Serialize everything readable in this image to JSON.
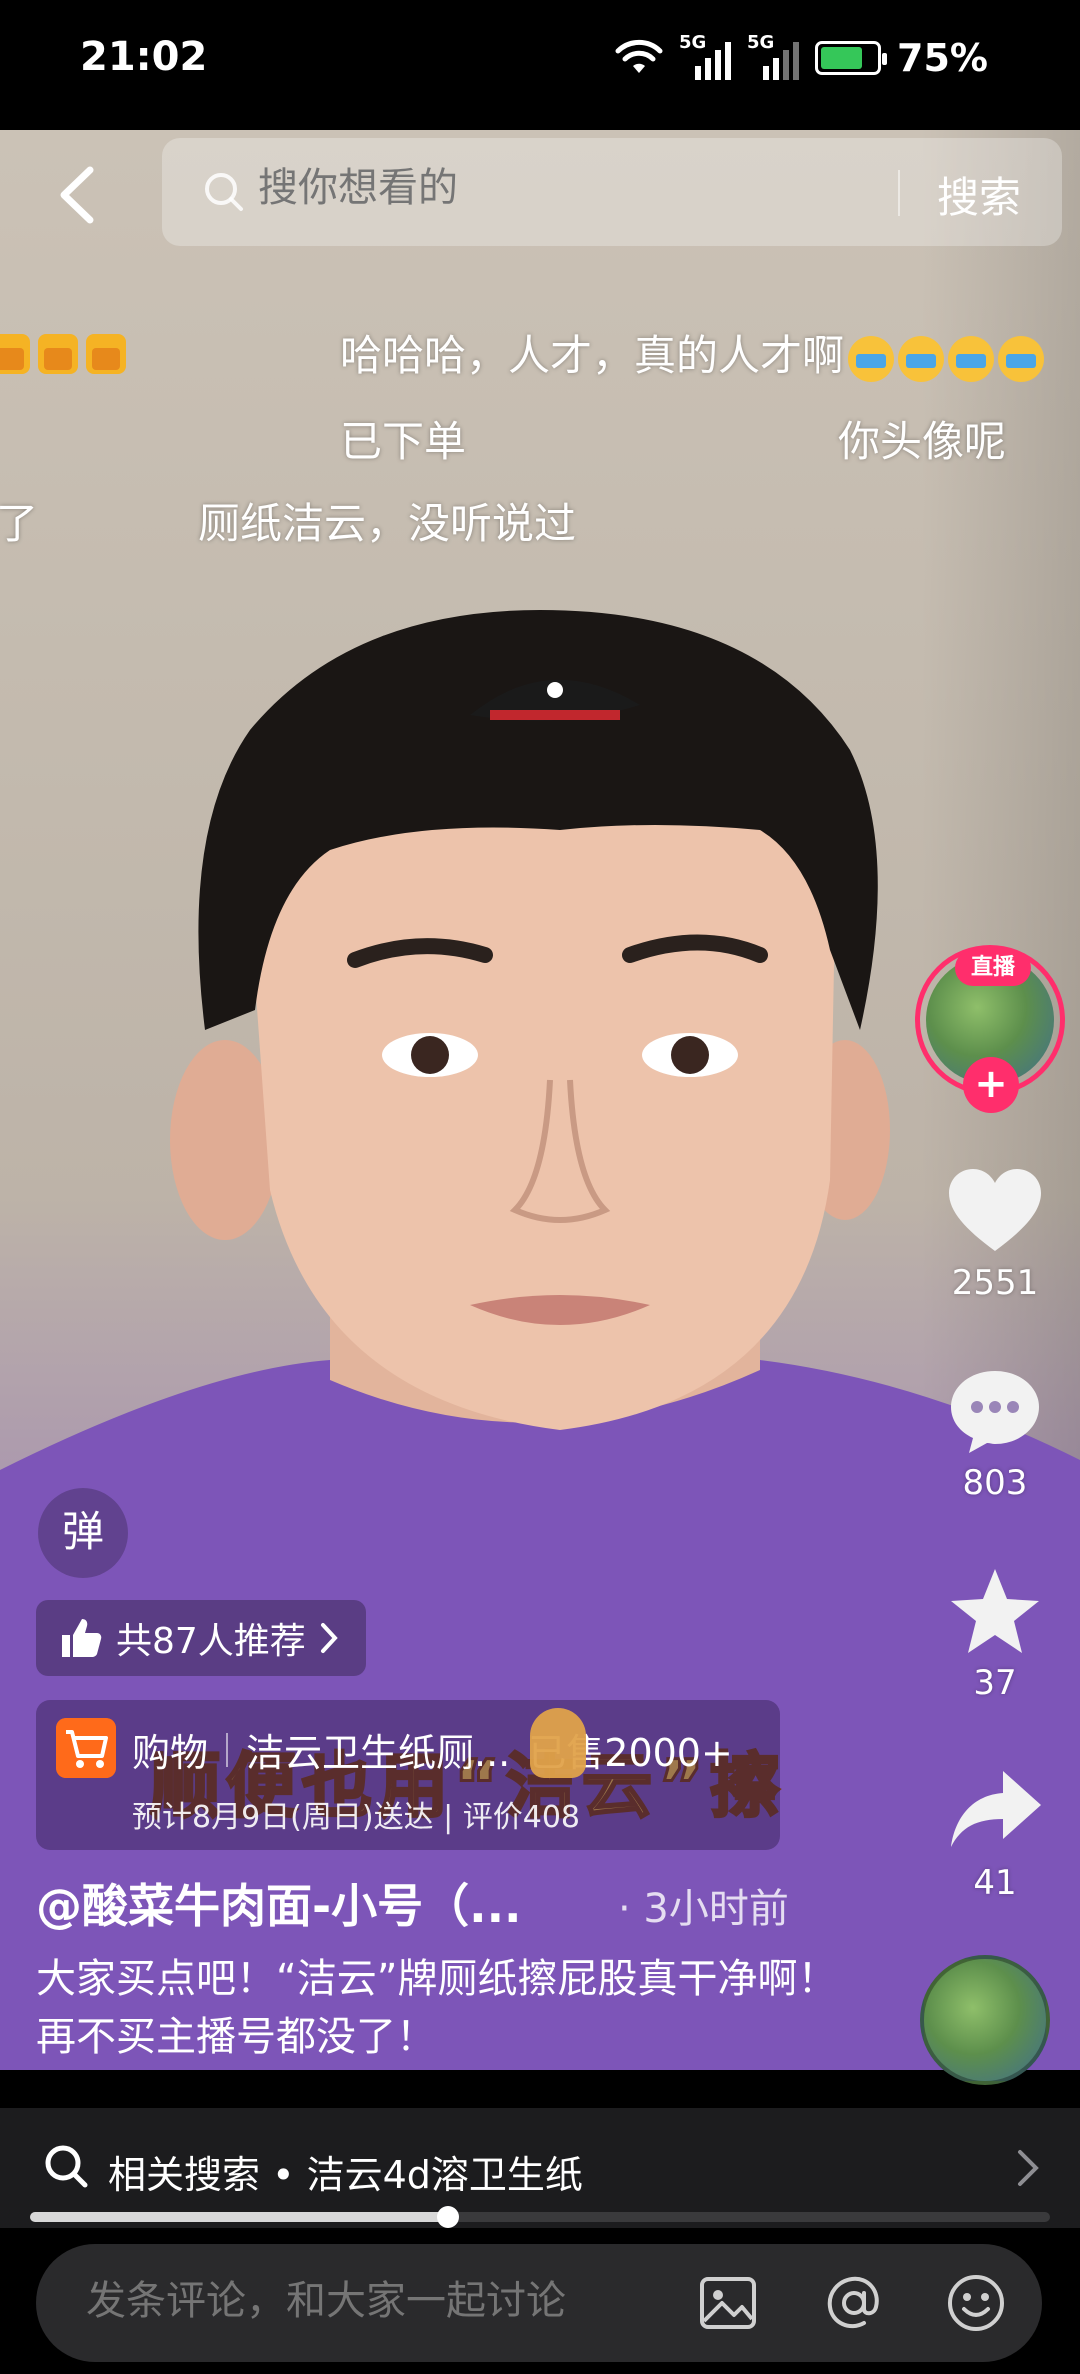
{
  "status": {
    "time": "21:02",
    "net1": "5G",
    "net2": "5G",
    "battery_pct": "75%",
    "battery_level": 0.75
  },
  "search": {
    "placeholder": "搜你想看的",
    "button": "搜索"
  },
  "danmaku": [
    {
      "text": "哈哈哈，人才，真的人才啊"
    },
    {
      "text": "已下单"
    },
    {
      "text": "你头像呢"
    },
    {
      "text": "厕纸洁云，没听说过"
    },
    {
      "text": "了"
    }
  ],
  "rail": {
    "live_badge": "直播",
    "likes": "2551",
    "comments": "803",
    "favorites": "37",
    "shares": "41"
  },
  "danmu_toggle": "弹",
  "caption": "顺便也用“洁云”擦",
  "recommend": {
    "text": "共87人推荐"
  },
  "shop": {
    "category": "购物",
    "product": "洁云卫生纸厕...",
    "sold": "已售2000+",
    "delivery": "预计8月9日(周日)送达 | 评价408"
  },
  "author": {
    "name": "@酸菜牛肉面-小号（...",
    "time": "· 3小时前"
  },
  "description": "大家买点吧！“洁云”牌厕纸擦屁股真干净啊！再不买主播号都没了！",
  "related": {
    "text": "相关搜索 • 洁云4d溶卫生纸"
  },
  "progress": 0.41,
  "comment": {
    "placeholder": "发条评论，和大家一起讨论"
  }
}
